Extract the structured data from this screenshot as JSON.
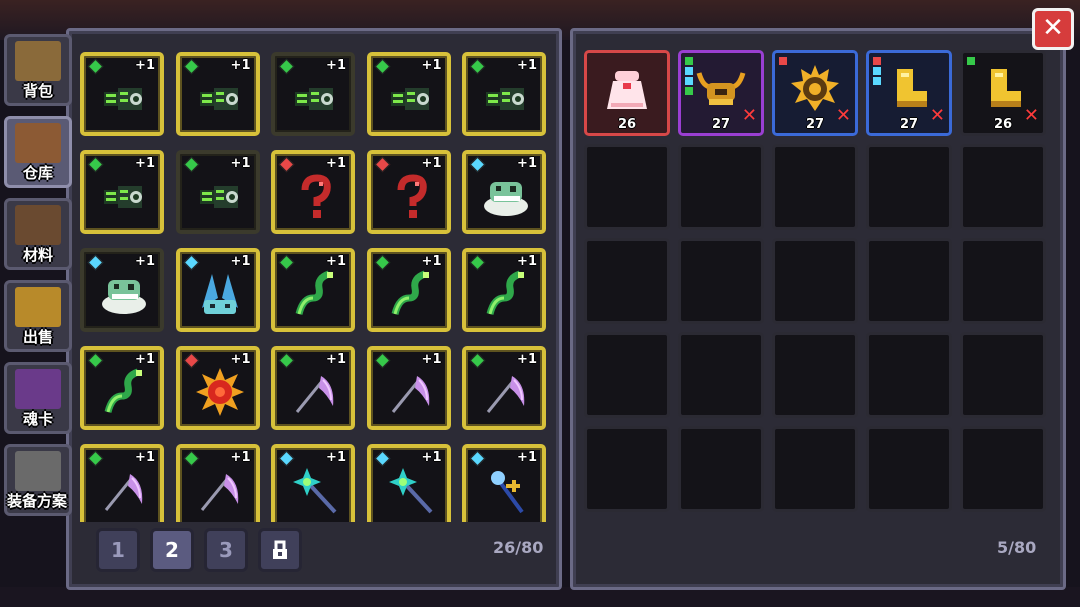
{
  "tabs": [
    {
      "label": "背包",
      "icon": "backpack-icon",
      "active": false
    },
    {
      "label": "仓库",
      "icon": "storage-chest-icon",
      "active": true
    },
    {
      "label": "材料",
      "icon": "materials-icon",
      "active": false
    },
    {
      "label": "出售",
      "icon": "sell-icon",
      "active": false
    },
    {
      "label": "魂卡",
      "icon": "soul-card-icon",
      "active": false
    },
    {
      "label": "装备方案",
      "icon": "equipment-set-icon",
      "active": false
    }
  ],
  "inventory": {
    "items": [
      {
        "icon": "green-serpent-icon",
        "gem": "#36c94a",
        "plus": "+1",
        "frame": "gold"
      },
      {
        "icon": "green-serpent-icon",
        "gem": "#36c94a",
        "plus": "+1",
        "frame": "gold"
      },
      {
        "icon": "green-serpent-icon",
        "gem": "#36c94a",
        "plus": "+1",
        "frame": "dark"
      },
      {
        "icon": "green-serpent-icon",
        "gem": "#36c94a",
        "plus": "+1",
        "frame": "gold"
      },
      {
        "icon": "green-serpent-icon",
        "gem": "#36c94a",
        "plus": "+1",
        "frame": "gold"
      },
      {
        "icon": "green-serpent-icon",
        "gem": "#36c94a",
        "plus": "+1",
        "frame": "gold"
      },
      {
        "icon": "green-serpent-icon",
        "gem": "#36c94a",
        "plus": "+1",
        "frame": "dark"
      },
      {
        "icon": "red-question-hook-icon",
        "gem": "#e84848",
        "plus": "+1",
        "frame": "gold"
      },
      {
        "icon": "red-question-hook-icon",
        "gem": "#e84848",
        "plus": "+1",
        "frame": "gold"
      },
      {
        "icon": "cloud-beast-icon",
        "gem": "#5ad8ff",
        "plus": "+1",
        "frame": "gold"
      },
      {
        "icon": "cloud-beast-icon",
        "gem": "#5ad8ff",
        "plus": "+1",
        "frame": "dark"
      },
      {
        "icon": "blue-crystal-beast-icon",
        "gem": "#5ad8ff",
        "plus": "+1",
        "frame": "gold"
      },
      {
        "icon": "green-whip-icon",
        "gem": "#36c94a",
        "plus": "+1",
        "frame": "gold"
      },
      {
        "icon": "green-whip-icon",
        "gem": "#36c94a",
        "plus": "+1",
        "frame": "gold"
      },
      {
        "icon": "green-whip-icon",
        "gem": "#36c94a",
        "plus": "+1",
        "frame": "gold"
      },
      {
        "icon": "green-whip-icon",
        "gem": "#36c94a",
        "plus": "+1",
        "frame": "gold"
      },
      {
        "icon": "red-sun-orb-icon",
        "gem": "#e84848",
        "plus": "+1",
        "frame": "gold"
      },
      {
        "icon": "purple-scythe-icon",
        "gem": "#36c94a",
        "plus": "+1",
        "frame": "gold"
      },
      {
        "icon": "purple-scythe-icon",
        "gem": "#36c94a",
        "plus": "+1",
        "frame": "gold"
      },
      {
        "icon": "purple-scythe-icon",
        "gem": "#36c94a",
        "plus": "+1",
        "frame": "gold"
      },
      {
        "icon": "purple-scythe-icon",
        "gem": "#36c94a",
        "plus": "+1",
        "frame": "gold"
      },
      {
        "icon": "purple-scythe-icon",
        "gem": "#36c94a",
        "plus": "+1",
        "frame": "gold"
      },
      {
        "icon": "teal-star-staff-icon",
        "gem": "#5ad8ff",
        "plus": "+1",
        "frame": "gold"
      },
      {
        "icon": "teal-star-staff-icon",
        "gem": "#5ad8ff",
        "plus": "+1",
        "frame": "gold"
      },
      {
        "icon": "golden-staff-icon",
        "gem": "#5ad8ff",
        "plus": "+1",
        "frame": "gold"
      }
    ],
    "pages": [
      "1",
      "2",
      "3"
    ],
    "active_page": 1,
    "lock_icon": "lock-icon",
    "count": "26/80"
  },
  "equipment": {
    "items": [
      {
        "icon": "pink-robe-icon",
        "level": "26",
        "rarity": "red",
        "removable": false,
        "dots": []
      },
      {
        "icon": "golden-horned-helm-icon",
        "level": "27",
        "rarity": "purple",
        "removable": true,
        "dots": [
          "#36c94a",
          "#5ad8ff",
          "#5ad8ff",
          "#36c94a"
        ]
      },
      {
        "icon": "spiked-sun-armor-icon",
        "level": "27",
        "rarity": "blue",
        "removable": true,
        "dots": [
          "#e84848"
        ]
      },
      {
        "icon": "golden-boots-icon",
        "level": "27",
        "rarity": "blue",
        "removable": true,
        "dots": [
          "#e84848",
          "#5ad8ff",
          "#5ad8ff"
        ]
      },
      {
        "icon": "golden-boots-icon",
        "level": "26",
        "rarity": "black",
        "removable": true,
        "dots": [
          "#36c94a"
        ]
      }
    ],
    "remove_label": "✕",
    "count": "5/80"
  },
  "close_label": "✕"
}
